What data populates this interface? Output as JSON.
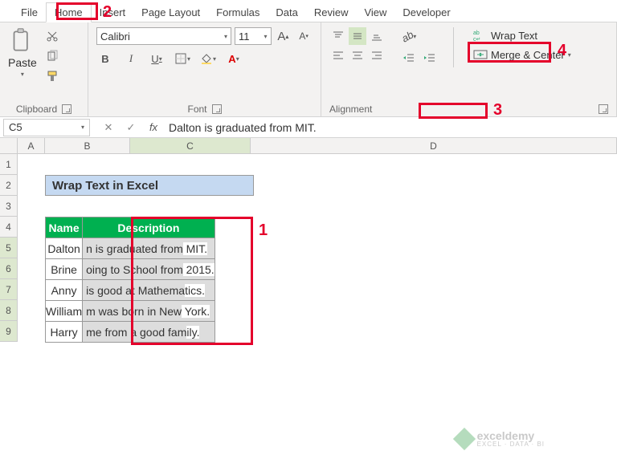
{
  "menubar": {
    "tabs": [
      "File",
      "Home",
      "Insert",
      "Page Layout",
      "Formulas",
      "Data",
      "Review",
      "View",
      "Developer"
    ],
    "active_index": 1
  },
  "ribbon": {
    "clipboard": {
      "label": "Clipboard",
      "paste": "Paste"
    },
    "font": {
      "label": "Font",
      "name": "Calibri",
      "size": "11",
      "btns": {
        "bold": "B",
        "italic": "I",
        "underline": "U"
      }
    },
    "alignment": {
      "label": "Alignment",
      "wrap": "Wrap Text",
      "merge": "Merge & Center"
    }
  },
  "formula_bar": {
    "cell_ref": "C5",
    "fx": "fx",
    "formula": "Dalton is graduated from MIT."
  },
  "columns": [
    "A",
    "B",
    "C",
    "D"
  ],
  "rows": [
    "1",
    "2",
    "3",
    "4",
    "5",
    "6",
    "7",
    "8",
    "9"
  ],
  "sheet": {
    "title": "Wrap Text in Excel",
    "headers": {
      "name": "Name",
      "desc": "Description"
    },
    "data": [
      {
        "name": "Dalton",
        "desc_visible": "n is graduated from",
        "desc_overflow": " MIT."
      },
      {
        "name": "Brine",
        "desc_visible": "oing to School from",
        "desc_overflow": " 2015."
      },
      {
        "name": "Anny",
        "desc_visible": "is good at Mathema",
        "desc_overflow": "tics."
      },
      {
        "name": "William",
        "desc_visible": "m was born in New",
        "desc_overflow": " York."
      },
      {
        "name": "Harry",
        "desc_visible": "me from a good fam",
        "desc_overflow": "ily."
      }
    ]
  },
  "annotations": {
    "a1": "1",
    "a2": "2",
    "a3": "3",
    "a4": "4"
  },
  "watermark": {
    "brand": "exceldemy",
    "tagline": "EXCEL · DATA · BI"
  }
}
